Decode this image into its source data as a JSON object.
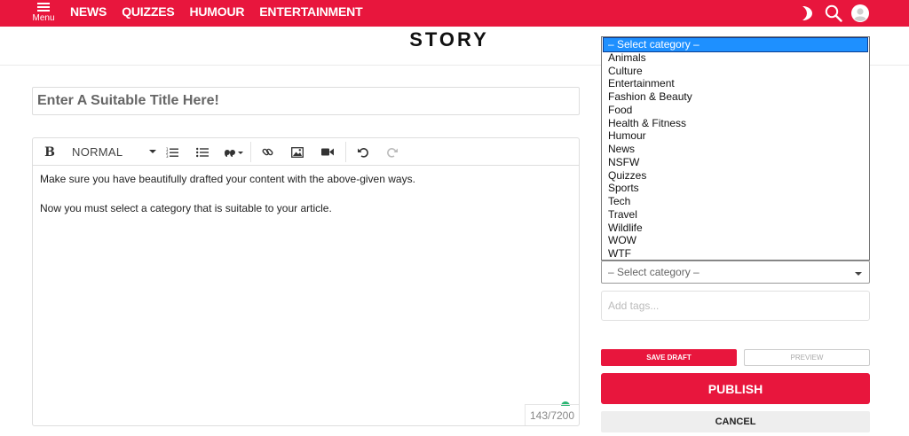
{
  "header": {
    "menu_label": "Menu",
    "nav": [
      "NEWS",
      "QUIZZES",
      "HUMOUR",
      "ENTERTAINMENT"
    ]
  },
  "page": {
    "title": "STORY"
  },
  "title_input": {
    "placeholder": "Enter A Suitable Title Here!"
  },
  "editor": {
    "format_value": "NORMAL",
    "paragraphs": [
      "Make sure you have beautifully drafted your content with the above-given ways.",
      "Now you must select a category that is suitable to your article."
    ],
    "counter": "143/7200",
    "toolbar_icons": [
      "bold-icon",
      "ordered-list-icon",
      "bullet-list-icon",
      "quote-icon",
      "link-icon",
      "image-icon",
      "video-icon",
      "undo-icon",
      "redo-icon"
    ]
  },
  "category": {
    "selected": "– Select category –",
    "options": [
      "– Select category –",
      "Animals",
      "Culture",
      "Entertainment",
      "Fashion & Beauty",
      "Food",
      "Health & Fitness",
      "Humour",
      "News",
      "NSFW",
      "Quizzes",
      "Sports",
      "Tech",
      "Travel",
      "Wildlife",
      "WOW",
      "WTF"
    ]
  },
  "tags": {
    "placeholder": "Add tags..."
  },
  "buttons": {
    "save_draft": "SAVE DRAFT",
    "preview": "PREVIEW",
    "publish": "PUBLISH",
    "cancel": "CANCEL"
  },
  "colors": {
    "accent": "#e8163d",
    "highlight": "#1e90ff"
  }
}
